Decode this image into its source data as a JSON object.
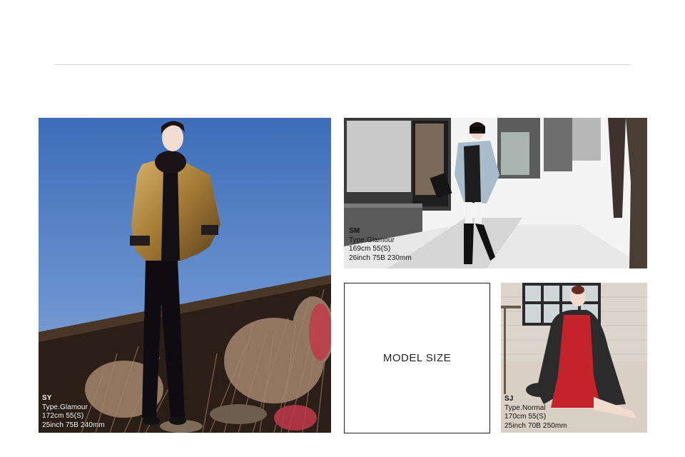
{
  "model_size_label": "MODEL SIZE",
  "models": {
    "sy": {
      "code": "SY",
      "type": "Type.Glamour",
      "height_size": "172cm 55(S)",
      "measurements": "25inch 75B 240mm"
    },
    "sm": {
      "code": "SM",
      "type": "Type.Glamour",
      "height_size": "169cm 55(S)",
      "measurements": "26inch 75B 230mm"
    },
    "sj": {
      "code": "SJ",
      "type": "Type.Normal",
      "height_size": "170cm 55(S)",
      "measurements": "25inch 70B 250mm"
    }
  },
  "colors": {
    "divider": "#d8d8d8",
    "box_border": "#222222",
    "sky": "#4f7fc4"
  }
}
